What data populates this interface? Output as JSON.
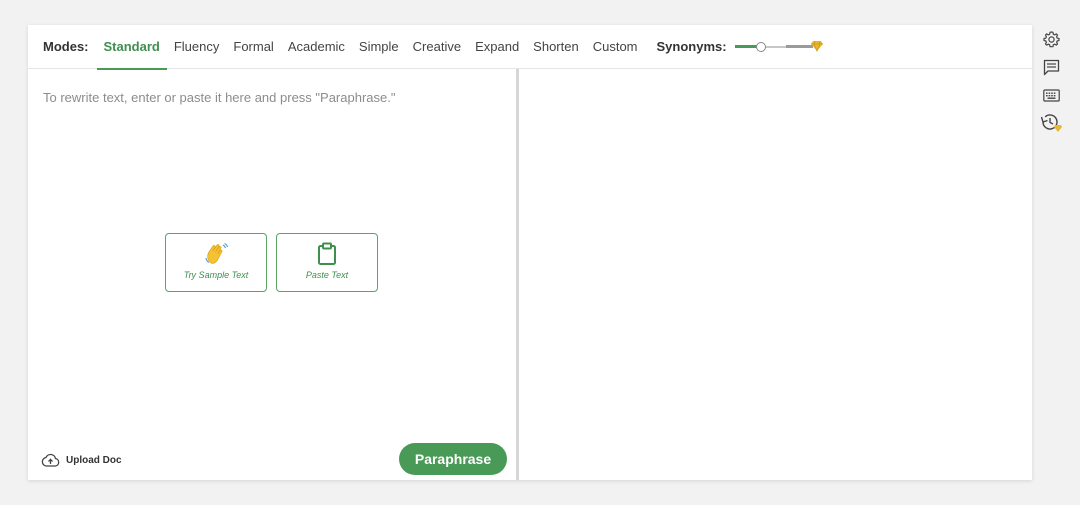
{
  "modes": {
    "label": "Modes:",
    "tabs": [
      {
        "label": "Standard",
        "active": true
      },
      {
        "label": "Fluency",
        "active": false
      },
      {
        "label": "Formal",
        "active": false
      },
      {
        "label": "Academic",
        "active": false
      },
      {
        "label": "Simple",
        "active": false
      },
      {
        "label": "Creative",
        "active": false
      },
      {
        "label": "Expand",
        "active": false
      },
      {
        "label": "Shorten",
        "active": false
      },
      {
        "label": "Custom",
        "active": false
      }
    ]
  },
  "synonyms": {
    "label": "Synonyms:",
    "level": 0.33,
    "premium_icon": "gem-icon"
  },
  "input": {
    "placeholder": "To rewrite text, enter or paste it here and press \"Paraphrase.\"",
    "try_sample_label": "Try Sample Text",
    "try_sample_icon": "waving-hand-icon",
    "paste_label": "Paste Text",
    "paste_icon": "clipboard-icon"
  },
  "footer": {
    "upload_label": "Upload Doc",
    "upload_icon": "cloud-upload-icon",
    "paraphrase_label": "Paraphrase"
  },
  "side_toolbar": {
    "icons": [
      "gear-icon",
      "comment-icon",
      "keyboard-icon",
      "history-icon"
    ]
  },
  "colors": {
    "accent": "#4a9a57",
    "accent_text": "#3f8f4e",
    "premium": "#e8b830"
  }
}
